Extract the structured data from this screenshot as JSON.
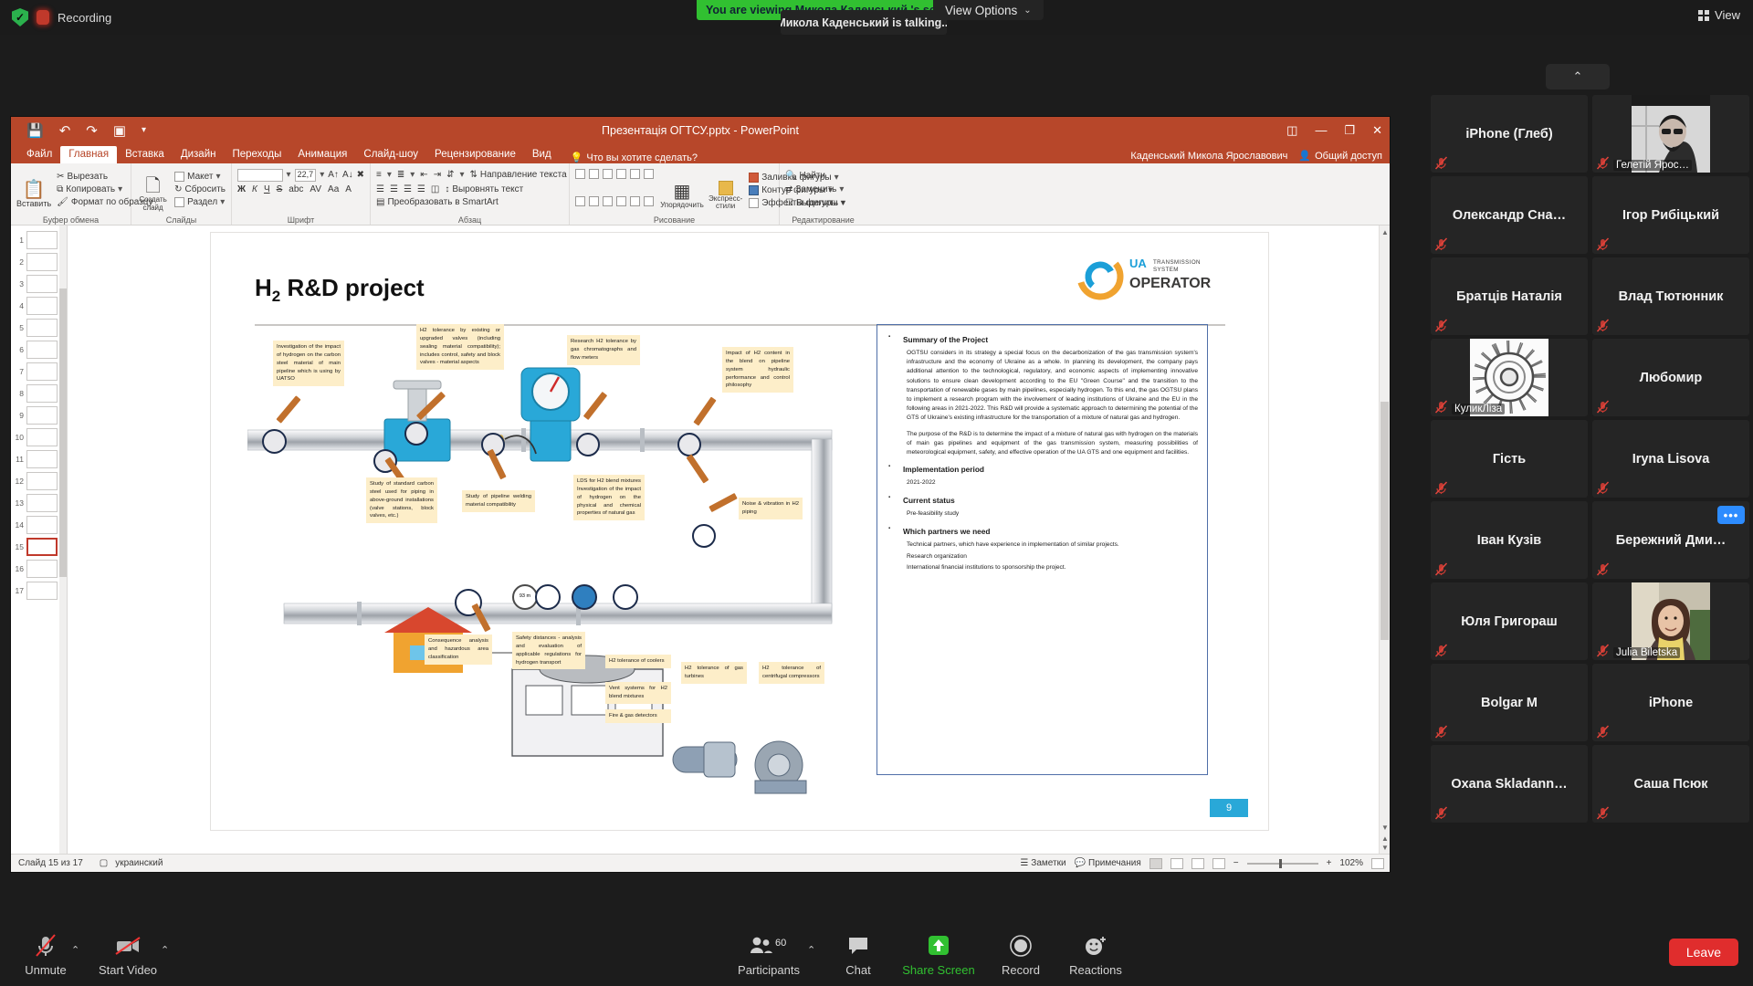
{
  "zoom_client": {
    "topbar": {
      "recording_label": "Recording",
      "shield_icon": "security-shield-icon",
      "record_icon": "recording-indicator-icon",
      "viewing_banner": "You are viewing Микола Каденський 's screen",
      "talking_indicator": "Микола Каденський  is talking...",
      "view_options_label": "View Options",
      "view_options_caret": "⌄",
      "view_button_label": "View"
    },
    "collapse_strip": {
      "caret": "⌃"
    },
    "participants": [
      {
        "name": "iPhone (Глеб)",
        "muted": true,
        "video": false
      },
      {
        "name": "Гелетій Ярос…",
        "muted": true,
        "video": true,
        "video_kind": "man-portrait"
      },
      {
        "name": "Олександр  Сна…",
        "muted": true,
        "video": false
      },
      {
        "name": "Ігор Рибіцький",
        "muted": true,
        "video": false
      },
      {
        "name": "Братців Наталія",
        "muted": true,
        "video": false
      },
      {
        "name": "Влад Тютюнник",
        "muted": true,
        "video": false
      },
      {
        "name": "КуликЛіза",
        "muted": true,
        "video": true,
        "video_kind": "spiral-avatar"
      },
      {
        "name": "Любомир",
        "muted": true,
        "video": false
      },
      {
        "name": "Гість",
        "muted": true,
        "video": false
      },
      {
        "name": "Iryna Lisova",
        "muted": true,
        "video": false
      },
      {
        "name": "Іван Кузів",
        "muted": true,
        "video": false
      },
      {
        "name": "Бережний  Дми…",
        "muted": true,
        "video": false,
        "more": "•••"
      },
      {
        "name": "Юля Григораш",
        "muted": true,
        "video": false
      },
      {
        "name": "Julia Biletska",
        "muted": true,
        "video": true,
        "video_kind": "woman-portrait"
      },
      {
        "name": "Bolgar M",
        "muted": true,
        "video": false
      },
      {
        "name": "iPhone",
        "muted": true,
        "video": false
      },
      {
        "name": "Oxana  Skladann…",
        "muted": true,
        "video": false
      },
      {
        "name": "Саша Псюк",
        "muted": true,
        "video": false
      }
    ],
    "toolbar": {
      "unmute": {
        "label": "Unmute",
        "icon": "microphone-muted-icon",
        "caret": "⌃"
      },
      "start_video": {
        "label": "Start Video",
        "icon": "camera-off-icon",
        "caret": "⌃"
      },
      "participants": {
        "label": "Participants",
        "icon": "participants-icon",
        "count": "60",
        "caret": "⌃"
      },
      "chat": {
        "label": "Chat",
        "icon": "chat-bubble-icon"
      },
      "share_screen": {
        "label": "Share Screen",
        "icon": "share-screen-icon"
      },
      "record": {
        "label": "Record",
        "icon": "record-circle-icon"
      },
      "reactions": {
        "label": "Reactions",
        "icon": "reactions-smiley-icon"
      },
      "leave": {
        "label": "Leave"
      }
    },
    "accent_colors": {
      "green": "#31c031",
      "blue": "#2d8cff",
      "red": "#e02d2d",
      "panel": "#252525"
    }
  },
  "powerpoint": {
    "title_bar": {
      "document_title": "Презентація ОГТСУ.pptx - PowerPoint",
      "qat": [
        "save-icon",
        "undo-icon",
        "redo-icon",
        "present-icon",
        "customize-icon"
      ],
      "ribbon_display_icon": "ribbon-display-options-icon",
      "minimize": "—",
      "restore": "❐",
      "close": "✕"
    },
    "ribbon": {
      "tabs": [
        {
          "label": "Файл",
          "active": false
        },
        {
          "label": "Главная",
          "active": true
        },
        {
          "label": "Вставка",
          "active": false
        },
        {
          "label": "Дизайн",
          "active": false
        },
        {
          "label": "Переходы",
          "active": false
        },
        {
          "label": "Анимация",
          "active": false
        },
        {
          "label": "Слайд-шоу",
          "active": false
        },
        {
          "label": "Рецензирование",
          "active": false
        },
        {
          "label": "Вид",
          "active": false
        }
      ],
      "tell_me": "Что вы хотите сделать?",
      "user_name": "Каденський Микола Ярославович",
      "share_label": "Общий доступ",
      "groups": [
        {
          "label": "Буфер обмена",
          "items": [
            "Вставить",
            "Вырезать",
            "Копировать",
            "Формат по образцу"
          ]
        },
        {
          "label": "Слайды",
          "items": [
            "Создать слайд",
            "Макет",
            "Сбросить",
            "Раздел"
          ]
        },
        {
          "label": "Шрифт",
          "items": [
            "Ж",
            "К",
            "Ч",
            "S",
            "abc",
            "AV",
            "Aa",
            "A"
          ],
          "font_name": "",
          "font_size": "22,7"
        },
        {
          "label": "Абзац",
          "items": [
            "Направление текста",
            "Выровнять текст",
            "Преобразовать в SmartArt"
          ]
        },
        {
          "label": "Рисование",
          "items": [
            "Упорядочить",
            "Экспресс-стили",
            "Заливка фигуры",
            "Контур фигуры",
            "Эффекты фигуры"
          ]
        },
        {
          "label": "Редактирование",
          "items": [
            "Найти",
            "Заменить",
            "Выделить"
          ]
        }
      ]
    },
    "thumbnails": {
      "numbers": [
        "1",
        "2",
        "3",
        "4",
        "5",
        "6",
        "7",
        "8",
        "9",
        "10",
        "11",
        "12",
        "13",
        "14",
        "15",
        "16",
        "17"
      ],
      "selected": "15"
    },
    "status_bar": {
      "slide_counter": "Слайд 15 из 17",
      "language": "украинский",
      "notes_label": "Заметки",
      "comments_label": "Примечания",
      "zoom_level": "102%",
      "zoom_minus": "−",
      "zoom_plus": "+",
      "fit_icon": "fit-slide-icon"
    }
  },
  "slide": {
    "title_main": "H",
    "title_sub": "2",
    "title_rest": " R&D project",
    "page_number": "9",
    "logo": {
      "line1": "TRANSMISSION",
      "line2": "SYSTEM",
      "brand_top": "UA",
      "brand_bottom": "OPERATOR",
      "color_orange": "#f0a330",
      "color_blue": "#1b9fd8"
    },
    "callouts": [
      {
        "id": "investigation",
        "text": "Investigation of the impact of hydrogen on the carbon steel material of main pipeline which is using by UATSO"
      },
      {
        "id": "h2-tolerance-valves",
        "text": "H2 tolerance by existing or upgraded valves (including sealing material compatibility); includes control, safety and block valves - material aspects"
      },
      {
        "id": "research-chromatographs",
        "text": "Research H2 tolerance by gas chromatographs and flow meters"
      },
      {
        "id": "impact-h2-blend",
        "text": "Impact of H2 content in the blend on pipeline system hydraulic performance and control philosophy"
      },
      {
        "id": "study-standard-carbon-steel",
        "text": "Study of standard carbon steel used for piping in above-ground installations (valve stations, block valves, etc.)"
      },
      {
        "id": "study-welding",
        "text": "Study of pipeline welding material compatibility"
      },
      {
        "id": "lds-h2-blend",
        "text": "LDS for H2 blend mixtures Investigation of the impact of hydrogen on the physical and chemical properties of natural gas"
      },
      {
        "id": "noise-vibration",
        "text": "Noise & vibration in H2 piping"
      },
      {
        "id": "consequence-analysis",
        "text": "Consequence analysis and hazardous area classification"
      },
      {
        "id": "safety-distances",
        "text": "Safety distances - analysis and evaluation of applicable regulations for hydrogen transport"
      },
      {
        "id": "h2-coolers",
        "text": "H2 tolerance of coolers"
      },
      {
        "id": "vent-systems",
        "text": "Vent systems for H2 blend mixtures"
      },
      {
        "id": "fire-gas-detectors",
        "text": "Fire & gas detectors"
      },
      {
        "id": "h2-gas-turbines",
        "text": "H2 tolerance of gas turbines"
      },
      {
        "id": "h2-compressors",
        "text": "H2 tolerance of centrifugal compressors"
      }
    ],
    "diagram_labels": {
      "distance": "93 m"
    },
    "summary": {
      "heading_summary": "Summary of the Project",
      "paragraph_1": "OGTSU considers in its strategy a special focus on the decarbonization of the gas transmission system's infrastructure and the economy of Ukraine as a whole. In planning its development, the company pays additional attention to the technological, regulatory, and economic aspects of implementing innovative solutions to ensure clean development according to the EU \"Green Course\" and the transition to the transportation of renewable gases by main pipelines, especially hydrogen. To this end, the gas OGTSU plans to implement a research program with the involvement of leading institutions of Ukraine and the EU in the following areas in 2021-2022. This R&D will provide a systematic approach to determining the potential of the GTS of Ukraine's existing infrastructure for the transportation of a mixture of natural gas and hydrogen.",
      "paragraph_2": "The purpose of the R&D is to determine the impact of a mixture of natural gas with hydrogen on the materials of main gas pipelines and equipment of the gas transmission system, measuring possibilities of meteorological equipment, safety, and effective operation of the UA GTS and one equipment and facilities.",
      "heading_implementation": "Implementation period",
      "implementation_value": "2021-2022",
      "heading_status": "Current status",
      "status_value": "Pre-feasibility study",
      "heading_partners": "Which partners we need",
      "partners_1": "Technical partners, which have experience in implementation of similar projects.",
      "partners_2": "Research organization",
      "partners_3": "International financial institutions to sponsorship the project."
    }
  }
}
